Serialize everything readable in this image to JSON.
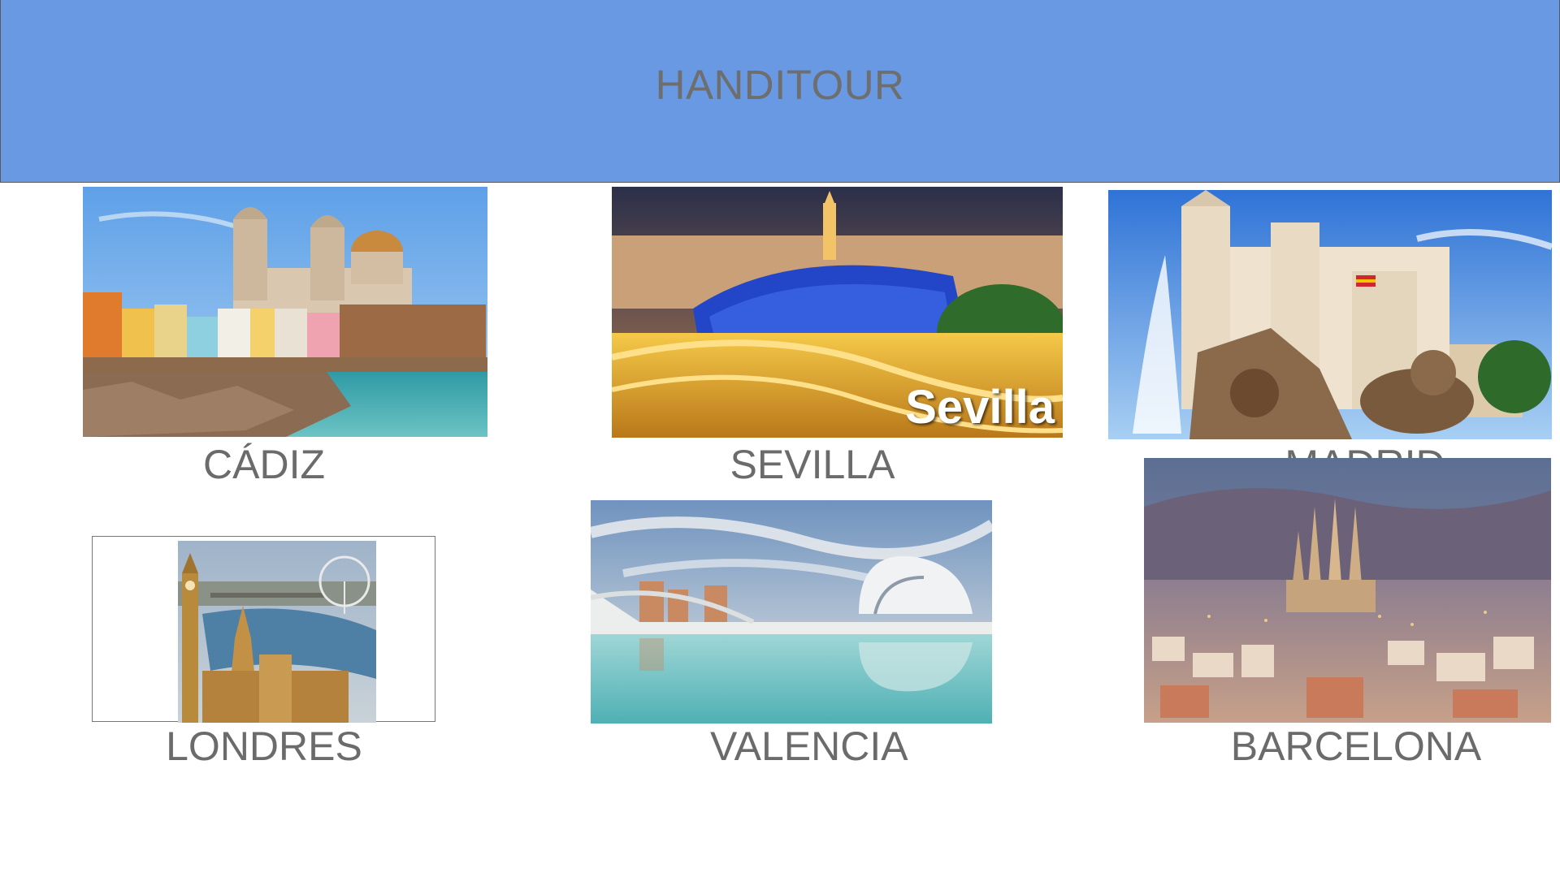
{
  "app": {
    "title": "HANDITOUR"
  },
  "destinations": [
    {
      "label": "CÁDIZ",
      "image": "cadiz-cathedral-photo"
    },
    {
      "label": "SEVILLA",
      "image": "sevilla-setas-photo",
      "overlay_text": "Sevilla"
    },
    {
      "label": "MADRID",
      "image": "madrid-cibeles-photo"
    },
    {
      "label": "LONDRES",
      "image": "london-westminster-photo"
    },
    {
      "label": "VALENCIA",
      "image": "valencia-arts-sciences-photo"
    },
    {
      "label": "BARCELONA",
      "image": "barcelona-sagrada-familia-photo"
    }
  ],
  "colors": {
    "header": "#6899e2",
    "text": "#6e6e6e",
    "background": "#ffffff"
  }
}
